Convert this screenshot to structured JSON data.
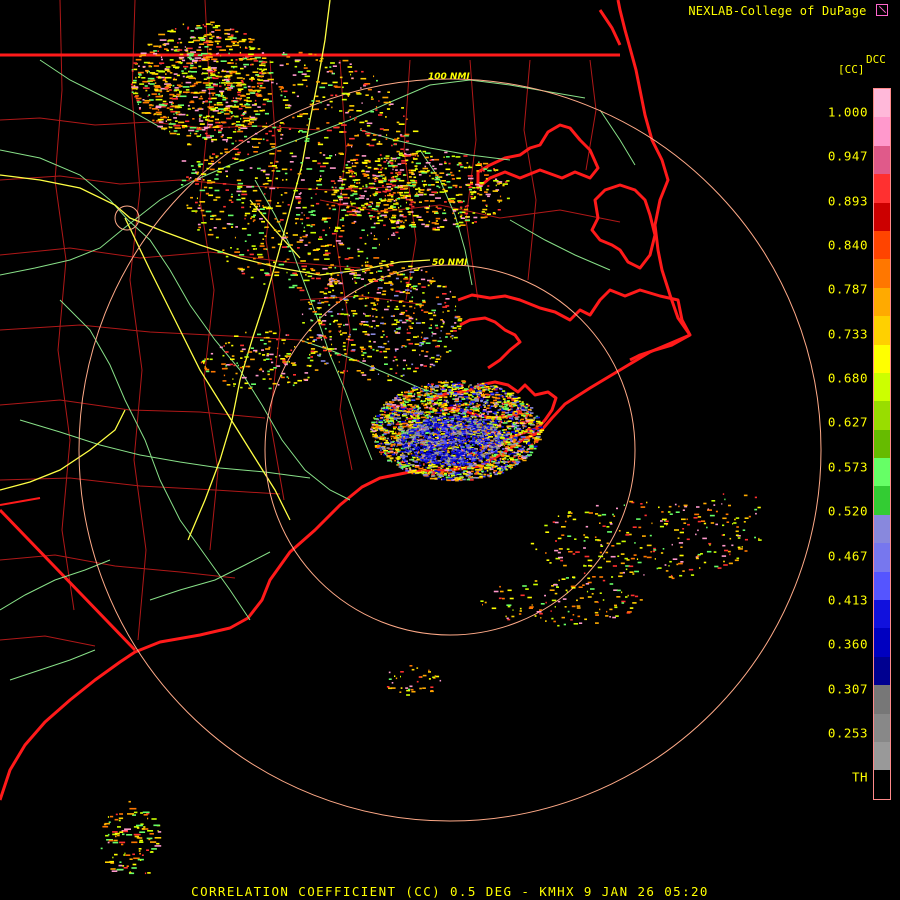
{
  "header": {
    "credit": "NEXLAB-College of DuPage",
    "logo_icon": "cod-logo-icon"
  },
  "legend": {
    "product_code": "DCC",
    "unit": "[CC]",
    "ticks": [
      "1.000",
      "0.947",
      "0.893",
      "0.840",
      "0.787",
      "0.733",
      "0.680",
      "0.627",
      "0.573",
      "0.520",
      "0.467",
      "0.413",
      "0.360",
      "0.307",
      "0.253",
      "TH"
    ],
    "colors": [
      "#ffb8d9",
      "#ff99cc",
      "#e05a8a",
      "#ff3030",
      "#cc0000",
      "#ff4400",
      "#ff7700",
      "#ffaa00",
      "#ffd000",
      "#ffff00",
      "#ccff00",
      "#99dd00",
      "#66bb00",
      "#66ff66",
      "#33cc33",
      "#8888dd",
      "#7777ee",
      "#5555ff",
      "#1111dd",
      "#0000c0",
      "#000090",
      "#777777",
      "#888888",
      "#999999",
      "#000000"
    ]
  },
  "map": {
    "ring_labels": [
      "100 NMI",
      "50 NMI"
    ],
    "colors": {
      "background": "#000000",
      "state_border": "#ff1a1a",
      "coastline": "#ff1a1a",
      "county_line": "#c01818",
      "interstate": "#ffff44",
      "highway": "#99ee99",
      "range_ring": "#ffaa88"
    }
  },
  "footer": {
    "caption": "CORRELATION COEFFICIENT (CC) 0.5 DEG - KMHX 9 JAN 26 05:20"
  }
}
